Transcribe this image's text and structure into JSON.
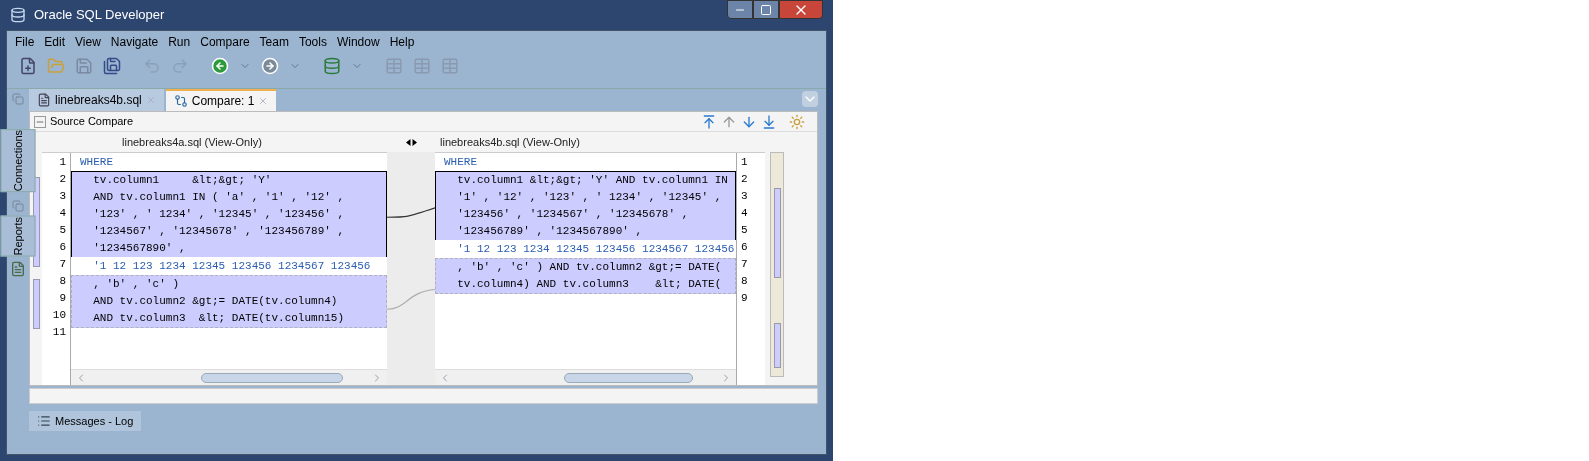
{
  "window": {
    "title": "Oracle SQL Developer"
  },
  "menu": [
    "File",
    "Edit",
    "View",
    "Navigate",
    "Run",
    "Compare",
    "Team",
    "Tools",
    "Window",
    "Help"
  ],
  "side_tabs": [
    "Connections",
    "Reports"
  ],
  "tabs": [
    {
      "label": "linebreaks4b.sql",
      "selected": false
    },
    {
      "label": "Compare: 1",
      "selected": true
    }
  ],
  "panel_title": "Source Compare",
  "left": {
    "header": "linebreaks4a.sql (View-Only)",
    "numbers": [
      "1",
      "2",
      "3",
      "4",
      "5",
      "6",
      "7",
      "8",
      "9",
      "10",
      "11"
    ],
    "blocks": [
      {
        "kind": "common",
        "lines": [
          "WHERE"
        ]
      },
      {
        "kind": "changed",
        "selected": true,
        "lines": [
          "  tv.column1     &lt;&gt; 'Y'",
          "  AND tv.column1 IN ( 'a' , '1' , '12' ,",
          "  '123' , ' 1234' , '12345' , '123456' ,",
          "  '1234567' , '12345678' , '123456789' ,",
          "  '1234567890' ,"
        ]
      },
      {
        "kind": "common",
        "lines": [
          "  '1 12 123 1234 12345 123456 1234567 123456"
        ]
      },
      {
        "kind": "changed",
        "selected": false,
        "lines": [
          "  , 'b' , 'c' )",
          "  AND tv.column2 &gt;= DATE(tv.column4)",
          "  AND tv.column3  &lt; DATE(tv.column15)"
        ]
      }
    ]
  },
  "right": {
    "header": "linebreaks4b.sql (View-Only)",
    "numbers": [
      "1",
      "2",
      "3",
      "4",
      "5",
      "6",
      "7",
      "8",
      "9"
    ],
    "blocks": [
      {
        "kind": "common",
        "lines": [
          "WHERE"
        ]
      },
      {
        "kind": "changed",
        "selected": true,
        "lines": [
          "  tv.column1 &lt;&gt; 'Y' AND tv.column1 IN",
          "  '1' , '12' , '123' , ' 1234' , '12345' ,",
          "  '123456' , '1234567' , '12345678' ,",
          "  '123456789' , '1234567890' ,"
        ]
      },
      {
        "kind": "common",
        "lines": [
          "  '1 12 123 1234 12345 123456 1234567 123456"
        ]
      },
      {
        "kind": "changed",
        "selected": false,
        "lines": [
          "  , 'b' , 'c' ) AND tv.column2 &gt;= DATE(",
          "  tv.column4) AND tv.column3    &lt; DATE("
        ]
      }
    ]
  },
  "bottom_tab": "Messages - Log"
}
